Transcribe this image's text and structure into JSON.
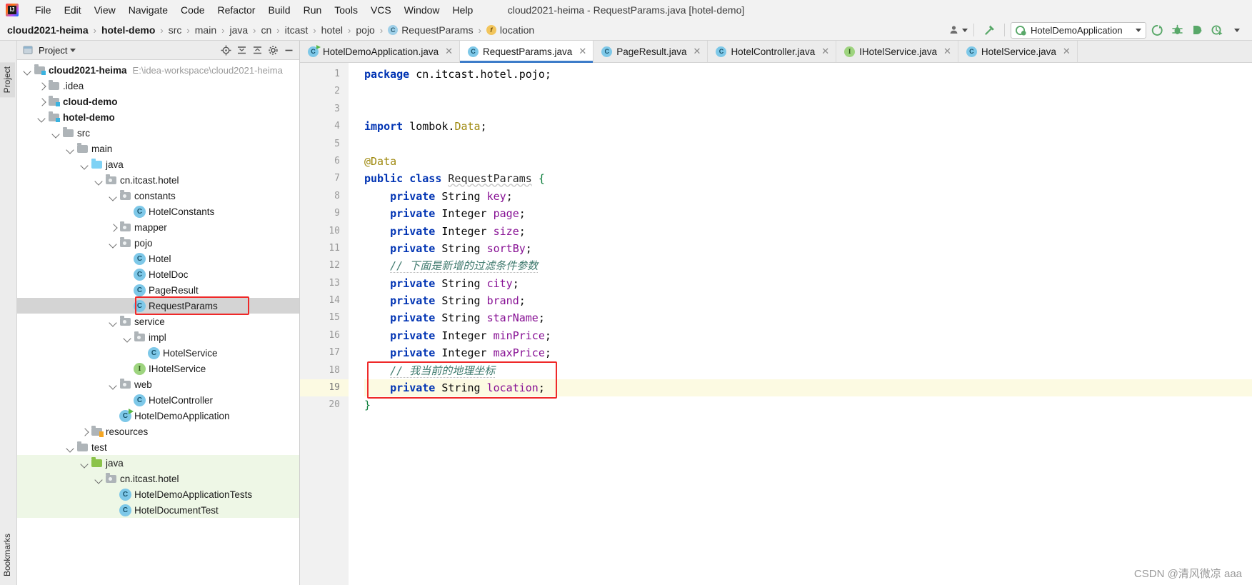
{
  "window": {
    "title": "cloud2021-heima - RequestParams.java [hotel-demo]"
  },
  "menubar": {
    "items": [
      {
        "label": "File"
      },
      {
        "label": "Edit"
      },
      {
        "label": "View"
      },
      {
        "label": "Navigate"
      },
      {
        "label": "Code"
      },
      {
        "label": "Refactor"
      },
      {
        "label": "Build"
      },
      {
        "label": "Run"
      },
      {
        "label": "Tools"
      },
      {
        "label": "VCS"
      },
      {
        "label": "Window"
      },
      {
        "label": "Help"
      }
    ]
  },
  "breadcrumb": {
    "items": [
      {
        "label": "cloud2021-heima",
        "bold": true,
        "icon": ""
      },
      {
        "label": "hotel-demo",
        "bold": true,
        "icon": ""
      },
      {
        "label": "src",
        "bold": false,
        "icon": ""
      },
      {
        "label": "main",
        "bold": false,
        "icon": ""
      },
      {
        "label": "java",
        "bold": false,
        "icon": ""
      },
      {
        "label": "cn",
        "bold": false,
        "icon": ""
      },
      {
        "label": "itcast",
        "bold": false,
        "icon": ""
      },
      {
        "label": "hotel",
        "bold": false,
        "icon": ""
      },
      {
        "label": "pojo",
        "bold": false,
        "icon": ""
      },
      {
        "label": "RequestParams",
        "bold": false,
        "icon": "class-icon",
        "icon_glyph": "C"
      },
      {
        "label": "location",
        "bold": false,
        "icon": "field-icon",
        "icon_glyph": "f"
      }
    ],
    "separator": "›"
  },
  "toolbar": {
    "run_config": "HotelDemoApplication",
    "icons": [
      {
        "name": "user-account-icon"
      },
      {
        "name": "hammer-build-icon"
      },
      {
        "name": "run-icon"
      },
      {
        "name": "debug-icon"
      },
      {
        "name": "run-with-coverage-icon"
      },
      {
        "name": "profiler-icon"
      },
      {
        "name": "more-chevron-icon"
      }
    ]
  },
  "left_strip": {
    "top_tab": "Project",
    "bottom_tab": "Bookmarks"
  },
  "project_panel": {
    "header_title": "Project",
    "header_icons": [
      {
        "name": "locate-target-icon"
      },
      {
        "name": "collapse-all-icon"
      },
      {
        "name": "expand-all-icon"
      },
      {
        "name": "settings-gear-icon"
      },
      {
        "name": "hide-minimize-icon"
      }
    ],
    "tree": [
      {
        "indent": 0,
        "arrow": "down",
        "icon": "module-folder",
        "label": "cloud2021-heima",
        "bold": true,
        "path": "E:\\idea-workspace\\cloud2021-heima"
      },
      {
        "indent": 1,
        "arrow": "right",
        "icon": "folder",
        "label": ".idea",
        "bold": false,
        "path": ""
      },
      {
        "indent": 1,
        "arrow": "right",
        "icon": "module-folder",
        "label": "cloud-demo",
        "bold": true,
        "path": ""
      },
      {
        "indent": 1,
        "arrow": "down",
        "icon": "module-folder",
        "label": "hotel-demo",
        "bold": true,
        "path": ""
      },
      {
        "indent": 2,
        "arrow": "down",
        "icon": "folder",
        "label": "src",
        "bold": false,
        "path": ""
      },
      {
        "indent": 3,
        "arrow": "down",
        "icon": "folder",
        "label": "main",
        "bold": false,
        "path": ""
      },
      {
        "indent": 4,
        "arrow": "down",
        "icon": "source-folder",
        "label": "java",
        "bold": false,
        "path": ""
      },
      {
        "indent": 5,
        "arrow": "down",
        "icon": "package-folder",
        "label": "cn.itcast.hotel",
        "bold": false,
        "path": ""
      },
      {
        "indent": 6,
        "arrow": "down",
        "icon": "package-folder",
        "label": "constants",
        "bold": false,
        "path": ""
      },
      {
        "indent": 7,
        "arrow": "none",
        "icon": "class",
        "label": "HotelConstants",
        "bold": false,
        "path": ""
      },
      {
        "indent": 6,
        "arrow": "right",
        "icon": "package-folder",
        "label": "mapper",
        "bold": false,
        "path": ""
      },
      {
        "indent": 6,
        "arrow": "down",
        "icon": "package-folder",
        "label": "pojo",
        "bold": false,
        "path": ""
      },
      {
        "indent": 7,
        "arrow": "none",
        "icon": "class",
        "label": "Hotel",
        "bold": false,
        "path": ""
      },
      {
        "indent": 7,
        "arrow": "none",
        "icon": "class",
        "label": "HotelDoc",
        "bold": false,
        "path": ""
      },
      {
        "indent": 7,
        "arrow": "none",
        "icon": "class",
        "label": "PageResult",
        "bold": false,
        "path": ""
      },
      {
        "indent": 7,
        "arrow": "none",
        "icon": "class",
        "label": "RequestParams",
        "bold": false,
        "path": "",
        "selected": true,
        "highlighted": true
      },
      {
        "indent": 6,
        "arrow": "down",
        "icon": "package-folder",
        "label": "service",
        "bold": false,
        "path": ""
      },
      {
        "indent": 7,
        "arrow": "down",
        "icon": "package-folder",
        "label": "impl",
        "bold": false,
        "path": ""
      },
      {
        "indent": 8,
        "arrow": "none",
        "icon": "class",
        "label": "HotelService",
        "bold": false,
        "path": ""
      },
      {
        "indent": 7,
        "arrow": "none",
        "icon": "interface",
        "label": "IHotelService",
        "bold": false,
        "path": ""
      },
      {
        "indent": 6,
        "arrow": "down",
        "icon": "package-folder",
        "label": "web",
        "bold": false,
        "path": ""
      },
      {
        "indent": 7,
        "arrow": "none",
        "icon": "class",
        "label": "HotelController",
        "bold": false,
        "path": ""
      },
      {
        "indent": 6,
        "arrow": "none",
        "icon": "spring-class",
        "label": "HotelDemoApplication",
        "bold": false,
        "path": ""
      },
      {
        "indent": 4,
        "arrow": "right",
        "icon": "resource-folder",
        "label": "resources",
        "bold": false,
        "path": ""
      },
      {
        "indent": 3,
        "arrow": "down",
        "icon": "folder",
        "label": "test",
        "bold": false,
        "path": ""
      },
      {
        "indent": 4,
        "arrow": "down",
        "icon": "test-source-folder",
        "label": "java",
        "bold": false,
        "path": "",
        "green": true
      },
      {
        "indent": 5,
        "arrow": "down",
        "icon": "package-folder",
        "label": "cn.itcast.hotel",
        "bold": false,
        "path": "",
        "green": true
      },
      {
        "indent": 6,
        "arrow": "none",
        "icon": "class",
        "label": "HotelDemoApplicationTests",
        "bold": false,
        "path": "",
        "green": true
      },
      {
        "indent": 6,
        "arrow": "none",
        "icon": "class",
        "label": "HotelDocumentTest",
        "bold": false,
        "path": "",
        "green": true
      }
    ]
  },
  "editor_tabs": [
    {
      "label": "HotelDemoApplication.java",
      "icon": "spring-class-icon",
      "icon_glyph": "C",
      "active": false
    },
    {
      "label": "RequestParams.java",
      "icon": "class-icon",
      "icon_glyph": "C",
      "active": true
    },
    {
      "label": "PageResult.java",
      "icon": "class-icon",
      "icon_glyph": "C",
      "active": false
    },
    {
      "label": "HotelController.java",
      "icon": "class-icon",
      "icon_glyph": "C",
      "active": false
    },
    {
      "label": "IHotelService.java",
      "icon": "interface-icon",
      "icon_glyph": "I",
      "active": false
    },
    {
      "label": "HotelService.java",
      "icon": "class-icon",
      "icon_glyph": "C",
      "active": false
    }
  ],
  "code": {
    "lines": [
      {
        "n": "1",
        "tokens": [
          {
            "t": "package ",
            "c": "kw"
          },
          {
            "t": "cn.itcast.hotel.pojo;",
            "c": "txt"
          }
        ]
      },
      {
        "n": "2",
        "tokens": []
      },
      {
        "n": "3",
        "tokens": []
      },
      {
        "n": "4",
        "tokens": [
          {
            "t": "import ",
            "c": "kw"
          },
          {
            "t": "lombok.",
            "c": "txt"
          },
          {
            "t": "Data",
            "c": "anno"
          },
          {
            "t": ";",
            "c": "txt"
          }
        ]
      },
      {
        "n": "5",
        "tokens": []
      },
      {
        "n": "6",
        "tokens": [
          {
            "t": "@Data",
            "c": "anno"
          }
        ]
      },
      {
        "n": "7",
        "tokens": [
          {
            "t": "public class ",
            "c": "kw"
          },
          {
            "t": "RequestParams",
            "c": "wave"
          },
          {
            "t": " ",
            "c": "txt"
          },
          {
            "t": "{",
            "c": "brace"
          }
        ]
      },
      {
        "n": "8",
        "tokens": [
          {
            "t": "    ",
            "c": "txt"
          },
          {
            "t": "private ",
            "c": "kw"
          },
          {
            "t": "String ",
            "c": "txt"
          },
          {
            "t": "key",
            "c": "fld"
          },
          {
            "t": ";",
            "c": "txt"
          }
        ]
      },
      {
        "n": "9",
        "tokens": [
          {
            "t": "    ",
            "c": "txt"
          },
          {
            "t": "private ",
            "c": "kw"
          },
          {
            "t": "Integer ",
            "c": "txt"
          },
          {
            "t": "page",
            "c": "fld"
          },
          {
            "t": ";",
            "c": "txt"
          }
        ]
      },
      {
        "n": "10",
        "tokens": [
          {
            "t": "    ",
            "c": "txt"
          },
          {
            "t": "private ",
            "c": "kw"
          },
          {
            "t": "Integer ",
            "c": "txt"
          },
          {
            "t": "size",
            "c": "fld"
          },
          {
            "t": ";",
            "c": "txt"
          }
        ]
      },
      {
        "n": "11",
        "tokens": [
          {
            "t": "    ",
            "c": "txt"
          },
          {
            "t": "private ",
            "c": "kw"
          },
          {
            "t": "String ",
            "c": "txt"
          },
          {
            "t": "sortBy",
            "c": "fld"
          },
          {
            "t": ";",
            "c": "txt"
          }
        ]
      },
      {
        "n": "12",
        "tokens": [
          {
            "t": "    ",
            "c": "txt"
          },
          {
            "t": "// 下面是新增的过滤条件参数",
            "c": "cmt-zh"
          }
        ]
      },
      {
        "n": "13",
        "tokens": [
          {
            "t": "    ",
            "c": "txt"
          },
          {
            "t": "private ",
            "c": "kw"
          },
          {
            "t": "String ",
            "c": "txt"
          },
          {
            "t": "city",
            "c": "fld"
          },
          {
            "t": ";",
            "c": "txt"
          }
        ]
      },
      {
        "n": "14",
        "tokens": [
          {
            "t": "    ",
            "c": "txt"
          },
          {
            "t": "private ",
            "c": "kw"
          },
          {
            "t": "String ",
            "c": "txt"
          },
          {
            "t": "brand",
            "c": "fld"
          },
          {
            "t": ";",
            "c": "txt"
          }
        ]
      },
      {
        "n": "15",
        "tokens": [
          {
            "t": "    ",
            "c": "txt"
          },
          {
            "t": "private ",
            "c": "kw"
          },
          {
            "t": "String ",
            "c": "txt"
          },
          {
            "t": "starName",
            "c": "fld"
          },
          {
            "t": ";",
            "c": "txt"
          }
        ]
      },
      {
        "n": "16",
        "tokens": [
          {
            "t": "    ",
            "c": "txt"
          },
          {
            "t": "private ",
            "c": "kw"
          },
          {
            "t": "Integer ",
            "c": "txt"
          },
          {
            "t": "minPrice",
            "c": "fld"
          },
          {
            "t": ";",
            "c": "txt"
          }
        ]
      },
      {
        "n": "17",
        "tokens": [
          {
            "t": "    ",
            "c": "txt"
          },
          {
            "t": "private ",
            "c": "kw"
          },
          {
            "t": "Integer ",
            "c": "txt"
          },
          {
            "t": "maxPrice",
            "c": "fld"
          },
          {
            "t": ";",
            "c": "txt"
          }
        ]
      },
      {
        "n": "18",
        "tokens": [
          {
            "t": "    ",
            "c": "txt"
          },
          {
            "t": "// 我当前的地理坐标",
            "c": "cmt-zh"
          }
        ]
      },
      {
        "n": "19",
        "tokens": [
          {
            "t": "    ",
            "c": "txt"
          },
          {
            "t": "private ",
            "c": "kw"
          },
          {
            "t": "String ",
            "c": "txt"
          },
          {
            "t": "location",
            "c": "fld"
          },
          {
            "t": ";",
            "c": "txt"
          }
        ],
        "current": true
      },
      {
        "n": "20",
        "tokens": [
          {
            "t": "}",
            "c": "brace"
          }
        ]
      }
    ]
  },
  "annotations": {
    "color": "#ef2929",
    "boxes": [
      {
        "name": "tree-requestparams-highlight"
      },
      {
        "name": "code-location-highlight"
      }
    ]
  },
  "watermark": {
    "text": "CSDN @清风微凉 aaa"
  }
}
